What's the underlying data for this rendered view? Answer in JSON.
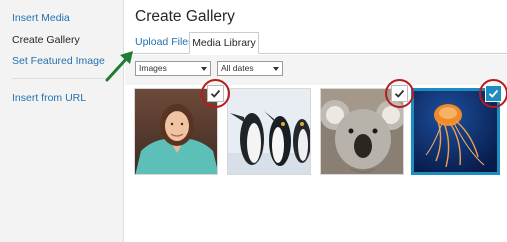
{
  "sidebar": {
    "items": [
      {
        "label": "Insert Media"
      },
      {
        "label": "Create Gallery"
      },
      {
        "label": "Set Featured Image"
      },
      {
        "label": "Insert from URL"
      }
    ]
  },
  "main": {
    "title": "Create Gallery",
    "tabs": [
      {
        "label": "Upload Files"
      },
      {
        "label": "Media Library"
      }
    ],
    "filters": {
      "type_select": "Images",
      "date_select": "All dates"
    },
    "attachments": [
      {
        "subject": "woman portrait",
        "selected": true,
        "active": false
      },
      {
        "subject": "penguins",
        "selected": false,
        "active": false
      },
      {
        "subject": "koala",
        "selected": true,
        "active": false
      },
      {
        "subject": "jellyfish",
        "selected": true,
        "active": true
      }
    ]
  },
  "colors": {
    "link": "#2271b1",
    "selection_blue": "#1e8cbe",
    "annotation_red": "#b71c1c",
    "annotation_green": "#1e7d32"
  },
  "icons": [
    "checkmark-icon",
    "dropdown-arrow-icon"
  ]
}
